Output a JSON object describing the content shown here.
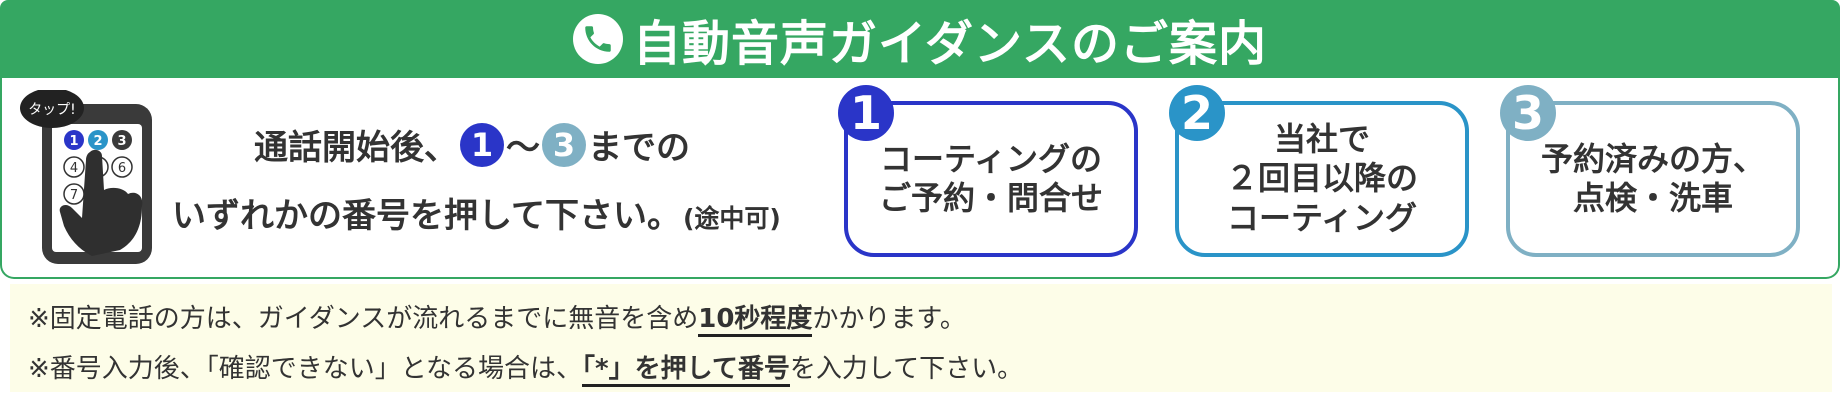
{
  "header": {
    "title": "自動音声ガイダンスのご案内",
    "icon": "phone-icon"
  },
  "device": {
    "tap_label": "タップ!",
    "keys": [
      "1",
      "2",
      "3",
      "4",
      "5",
      "6",
      "7"
    ]
  },
  "instructions": {
    "line1_prefix": "通話開始後、",
    "from_number": "1",
    "range_sep": "〜",
    "to_number": "3",
    "line1_suffix": "までの",
    "line2_main": "いずれかの番号を押して下さい。",
    "line2_note": "(途中可)"
  },
  "options": [
    {
      "number": "1",
      "label": "コーティングの\nご予約・問合せ",
      "color": "#2a35c8"
    },
    {
      "number": "2",
      "label": "当社で\n２回目以降の\nコーティング",
      "color": "#2a94c8"
    },
    {
      "number": "3",
      "label": "予約済みの方、\n点検・洗車",
      "color": "#7fb0c4"
    }
  ],
  "notes": {
    "note1_prefix": "※固定電話の方は、ガイダンスが流れるまでに無音を含め",
    "note1_bold": "10秒程度",
    "note1_suffix": "かかります。",
    "note2_prefix": "※番号入力後、「確認できない」となる場合は、",
    "note2_bold": "「*」を押して番号",
    "note2_suffix": "を入力して下さい。"
  },
  "colors": {
    "brand_green": "#35a762",
    "note_bg": "#fdfde8"
  }
}
